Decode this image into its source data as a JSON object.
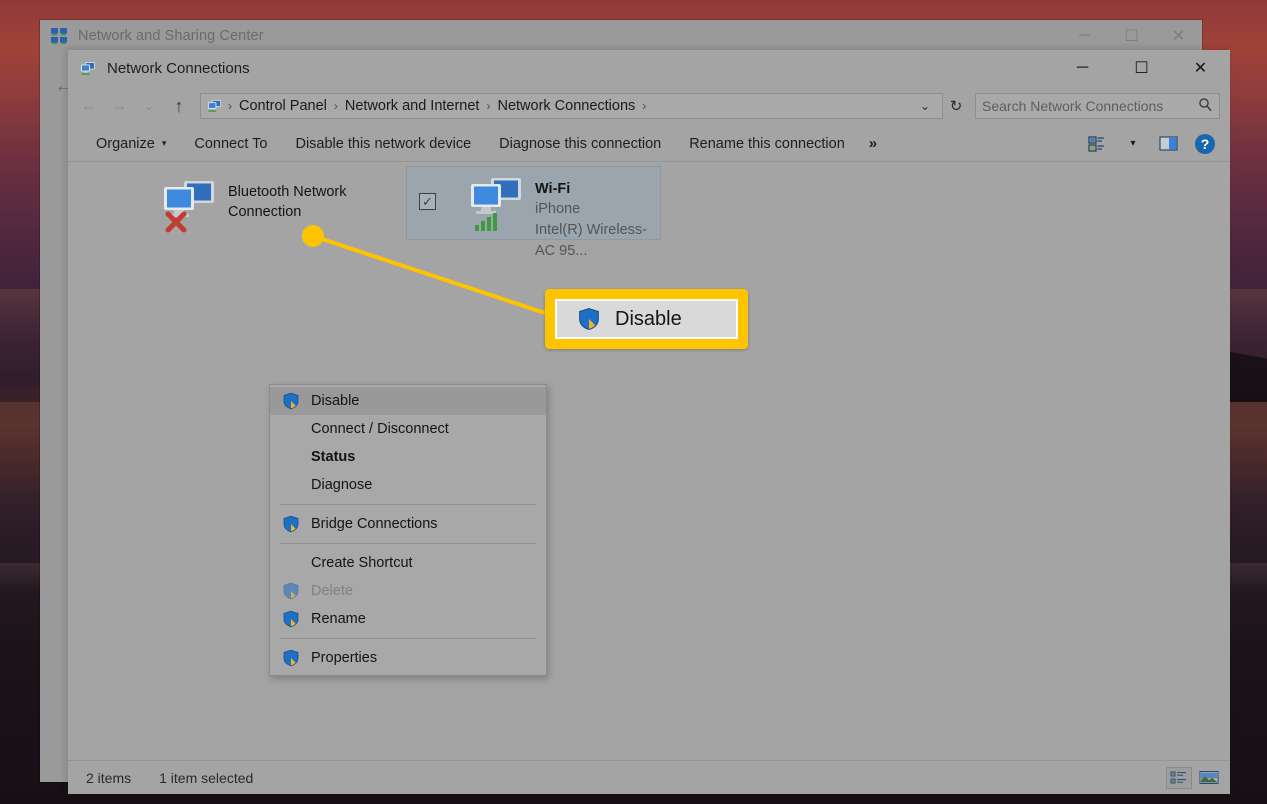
{
  "desktop": {
    "name": "sunset-wallpaper"
  },
  "background_window": {
    "title": "Network and Sharing Center",
    "icon": "network-sharing-icon",
    "back_arrow": "←",
    "controls": {
      "minimize": "─",
      "maximize": "☐",
      "close": "✕"
    }
  },
  "window": {
    "title": "Network Connections",
    "icon": "network-connections-icon",
    "controls": {
      "minimize": "─",
      "maximize": "☐",
      "close": "✕"
    }
  },
  "navigation": {
    "back": "←",
    "forward": "→",
    "recent": "⌄",
    "up": "↑",
    "dropdown": "⌄",
    "refresh": "↻"
  },
  "address_bar": {
    "icon": "network-connections-icon",
    "separator": "›",
    "crumbs": [
      "Control Panel",
      "Network and Internet",
      "Network Connections"
    ]
  },
  "search": {
    "placeholder": "Search Network Connections",
    "icon": "search-icon"
  },
  "toolbar": {
    "items": [
      {
        "label": "Organize",
        "has_caret": true
      },
      {
        "label": "Connect To",
        "has_caret": false
      },
      {
        "label": "Disable this network device",
        "has_caret": false
      },
      {
        "label": "Diagnose this connection",
        "has_caret": false
      },
      {
        "label": "Rename this connection",
        "has_caret": false
      }
    ],
    "overflow": "»",
    "caret": "▾",
    "view_icon": "change-view-icon",
    "view_caret": "▾",
    "preview_pane_icon": "preview-pane-icon",
    "help_icon": "help-icon",
    "help_glyph": "?"
  },
  "adapters": [
    {
      "name": "Bluetooth Network Connection",
      "subtitle": "",
      "detail": "",
      "icon": "network-adapter-disabled-icon",
      "overlay": "red-x-icon",
      "selected": false,
      "checked": false
    },
    {
      "name": "Wi-Fi",
      "subtitle": "iPhone",
      "detail": "Intel(R) Wireless-AC 95...",
      "icon": "network-adapter-icon",
      "overlay": "wifi-signal-icon",
      "selected": true,
      "checked": true,
      "checkmark": "✓"
    }
  ],
  "context_menu": {
    "items": [
      {
        "label": "Disable",
        "icon": "shield-icon",
        "highlighted": true,
        "bold": false,
        "disabled": false
      },
      {
        "label": "Connect / Disconnect",
        "icon": null,
        "highlighted": false,
        "bold": false,
        "disabled": false
      },
      {
        "label": "Status",
        "icon": null,
        "highlighted": false,
        "bold": true,
        "disabled": false
      },
      {
        "label": "Diagnose",
        "icon": null,
        "highlighted": false,
        "bold": false,
        "disabled": false
      },
      {
        "separator": true
      },
      {
        "label": "Bridge Connections",
        "icon": "shield-icon",
        "highlighted": false,
        "bold": false,
        "disabled": false
      },
      {
        "separator": true
      },
      {
        "label": "Create Shortcut",
        "icon": null,
        "highlighted": false,
        "bold": false,
        "disabled": false
      },
      {
        "label": "Delete",
        "icon": "shield-icon",
        "highlighted": false,
        "bold": false,
        "disabled": true
      },
      {
        "label": "Rename",
        "icon": "shield-icon",
        "highlighted": false,
        "bold": false,
        "disabled": false
      },
      {
        "separator": true
      },
      {
        "label": "Properties",
        "icon": "shield-icon",
        "highlighted": false,
        "bold": false,
        "disabled": false
      }
    ]
  },
  "annotation": {
    "callout_label": "Disable",
    "callout_icon": "shield-icon",
    "accent_color": "#ffc400",
    "dot_color": "#ffc400",
    "line_color": "#ffc400"
  },
  "status_bar": {
    "item_count": "2 items",
    "selection": "1 item selected",
    "details_view_icon": "details-view-icon",
    "icons_view_icon": "large-icons-view-icon"
  }
}
